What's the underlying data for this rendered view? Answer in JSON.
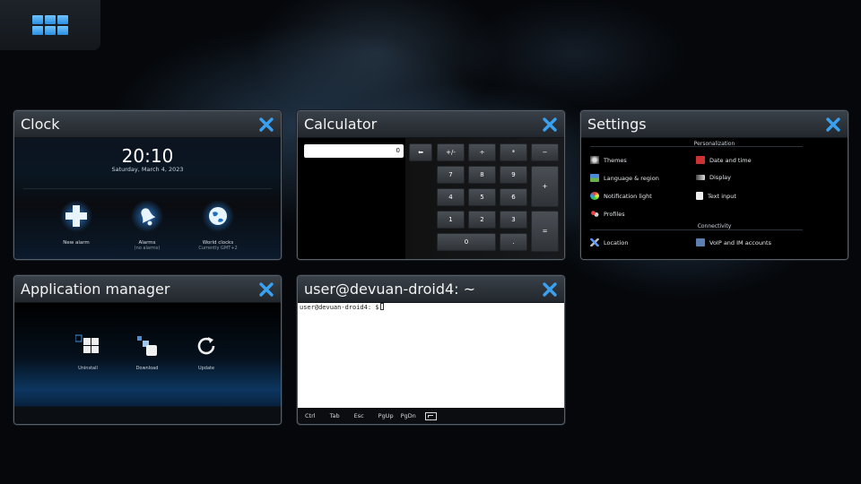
{
  "launcher": {
    "icon": "app-grid-icon"
  },
  "colors": {
    "accent": "#2b8ee0",
    "close": "#3aa0f0",
    "card_border": "#56606a"
  },
  "cards": {
    "clock": {
      "title": "Clock",
      "time": "20:10",
      "date": "Saturday, March 4, 2023",
      "items": [
        {
          "label": "New alarm",
          "sub": "",
          "icon": "plus-icon"
        },
        {
          "label": "Alarms",
          "sub": "(no alarms)",
          "icon": "bell-icon"
        },
        {
          "label": "World clocks",
          "sub": "Currently GMT+2",
          "icon": "globe-icon"
        }
      ]
    },
    "calculator": {
      "title": "Calculator",
      "display": "0",
      "keys": {
        "backspace": "⬅",
        "plusminus": "+/-",
        "divide": "÷",
        "multiply": "*",
        "minus": "−",
        "k7": "7",
        "k8": "8",
        "k9": "9",
        "plus": "+",
        "k4": "4",
        "k5": "5",
        "k6": "6",
        "k1": "1",
        "k2": "2",
        "k3": "3",
        "equals": "=",
        "k0": "0",
        "dot": "."
      }
    },
    "settings": {
      "title": "Settings",
      "section_personalization": "Personalization",
      "section_connectivity": "Connectivity",
      "items": {
        "themes": "Themes",
        "date_time": "Date and time",
        "language": "Language & region",
        "display": "Display",
        "notification": "Notification light",
        "text_input": "Text input",
        "profiles": "Profiles",
        "location": "Location",
        "voip": "VoIP and IM accounts"
      }
    },
    "appmgr": {
      "title": "Application manager",
      "items": [
        {
          "label": "Uninstall",
          "icon": "uninstall-icon"
        },
        {
          "label": "Download",
          "icon": "download-icon"
        },
        {
          "label": "Update",
          "icon": "update-icon"
        }
      ]
    },
    "terminal": {
      "title": "user@devuan-droid4: ~",
      "prompt": "user@devuan-droid4: $",
      "toolbar": [
        "Ctrl",
        "Tab",
        "Esc",
        "PgUp",
        "PgDn"
      ],
      "keyboard_icon": "keyboard-icon"
    }
  }
}
